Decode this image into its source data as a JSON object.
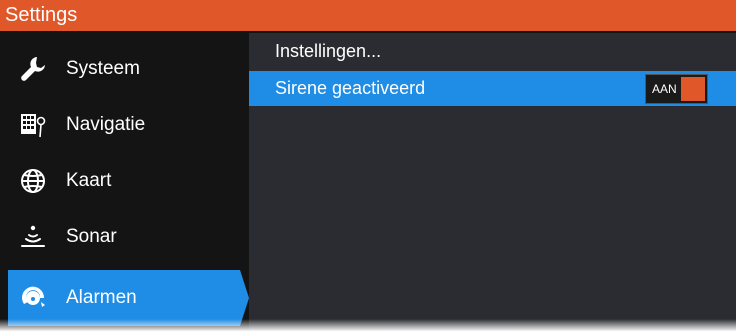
{
  "window": {
    "title": "Settings"
  },
  "sidebar": {
    "items": [
      {
        "label": "Systeem",
        "icon": "wrench-icon"
      },
      {
        "label": "Navigatie",
        "icon": "navigation-icon"
      },
      {
        "label": "Kaart",
        "icon": "globe-icon"
      },
      {
        "label": "Sonar",
        "icon": "sonar-icon"
      },
      {
        "label": "Alarmen",
        "icon": "alarm-icon",
        "selected": true
      }
    ]
  },
  "content": {
    "settings_label": "Instellingen...",
    "siren_label": "Sirene geactiveerd",
    "siren_toggle_state": "AAN"
  },
  "colors": {
    "title_bar": "#e0582a",
    "selection": "#1f8ce6",
    "toggle_knob": "#e0582a",
    "sidebar_bg": "#141414",
    "content_bg": "#2a2c31"
  }
}
